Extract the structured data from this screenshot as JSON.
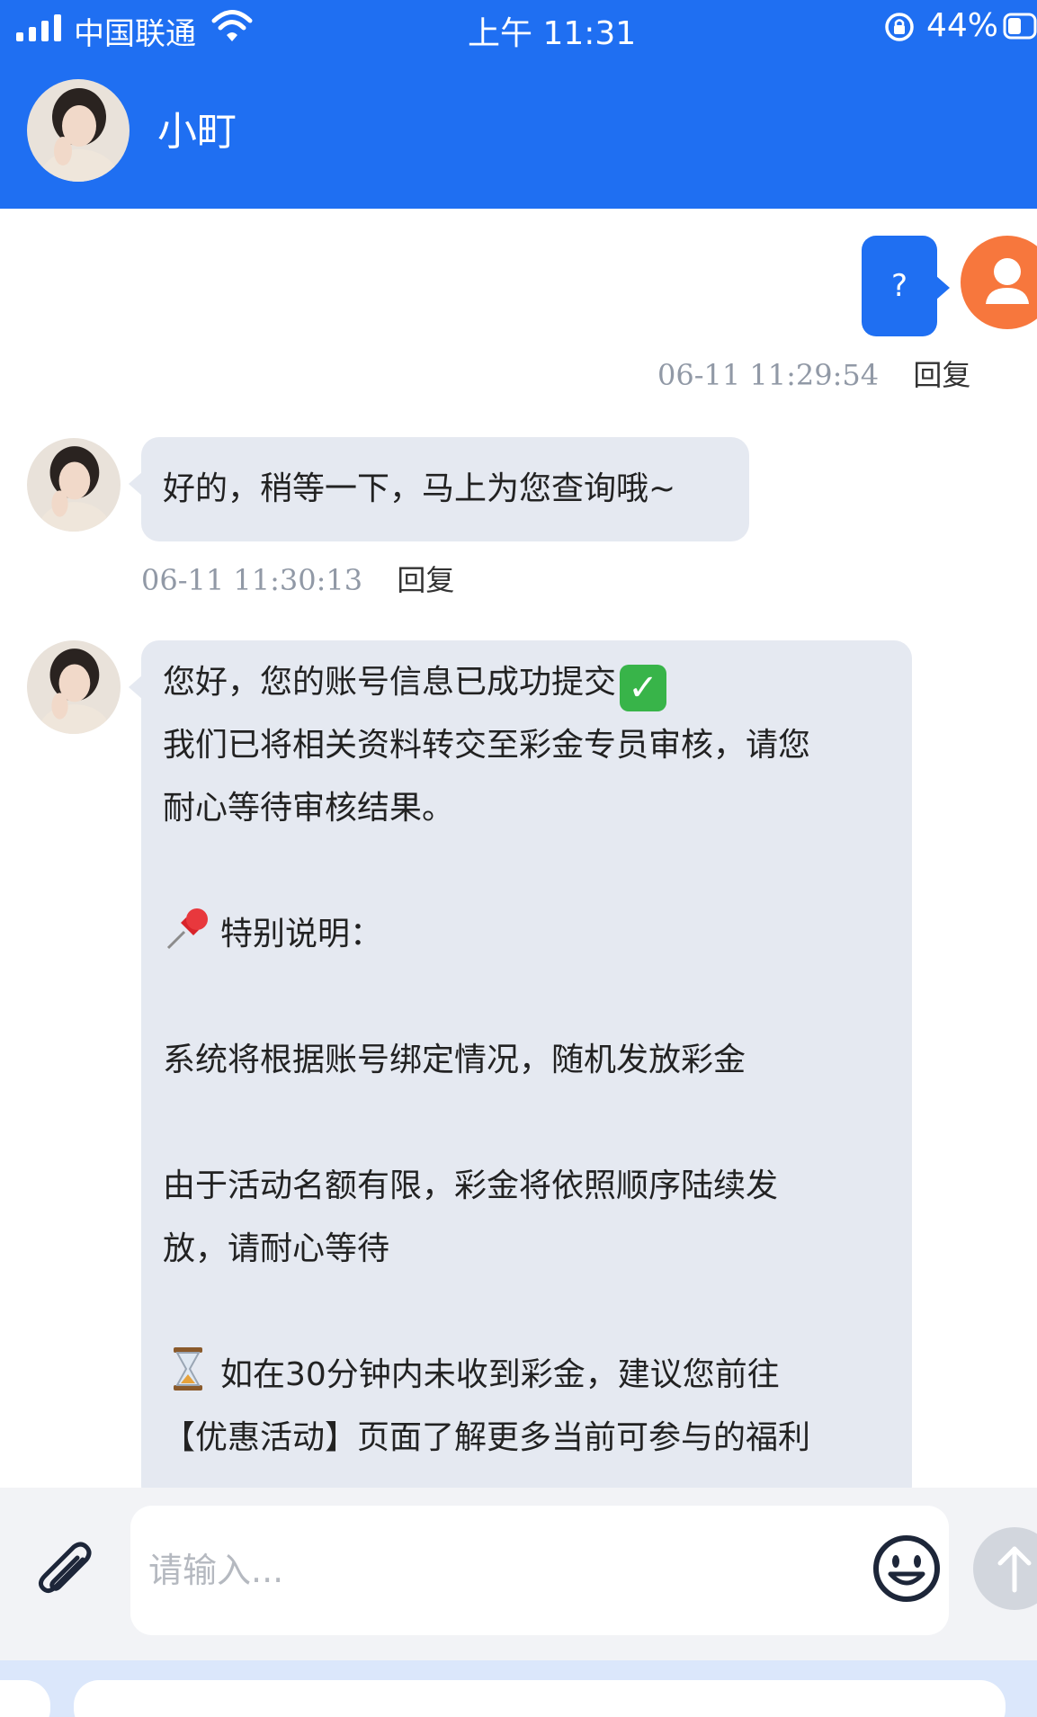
{
  "status_bar": {
    "carrier": "中国联通",
    "time": "上午 11:31",
    "battery": "44%"
  },
  "header": {
    "contact_name": "小町"
  },
  "messages": {
    "user": {
      "text": "?",
      "time": "06-11 11:29:54",
      "reply": "回复"
    },
    "agent1": {
      "text": "好的，稍等一下，马上为您查询哦~",
      "time": "06-11 11:30:13",
      "reply": "回复"
    },
    "agent2": {
      "line1": "您好，您的账号信息已成功提交",
      "line2": "我们已将相关资料转交至彩金专员审核，请您",
      "line3": "耐心等待审核结果。",
      "line4": "特别说明：",
      "line5": "系统将根据账号绑定情况，随机发放彩金",
      "line6": "由于活动名额有限，彩金将依照顺序陆续发",
      "line7": "放，请耐心等待",
      "line8": "如在30分钟内未收到彩金，建议您前往",
      "line9": "【优惠活动】页面了解更多当前可参与的福利"
    }
  },
  "input": {
    "placeholder": "请输入..."
  },
  "colors": {
    "brand_blue": "#1f6ff2",
    "agent_bubble": "#e5e9f1",
    "user_avatar": "#f7773d"
  }
}
